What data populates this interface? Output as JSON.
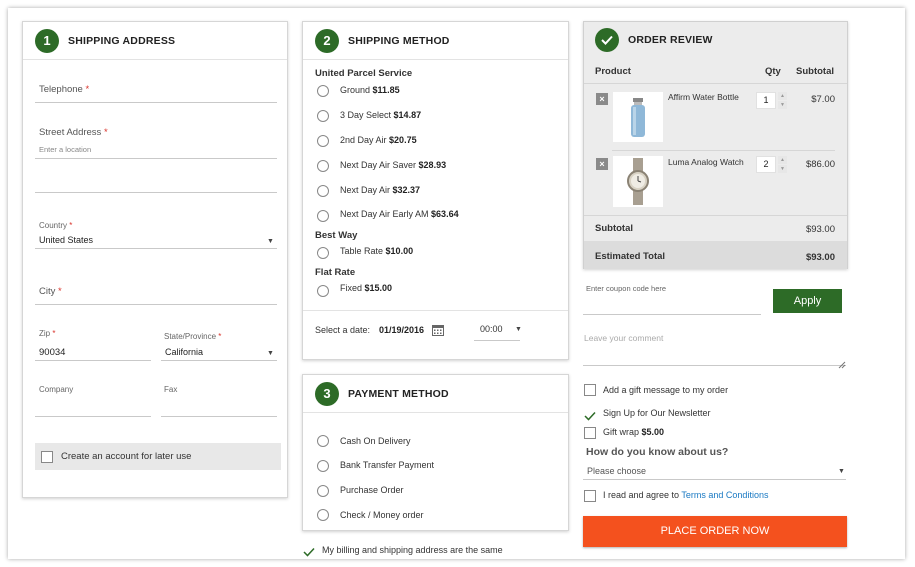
{
  "shipping_address": {
    "step": "1",
    "title": "SHIPPING ADDRESS",
    "telephone_label": "Telephone",
    "street_label": "Street Address",
    "street_placeholder": "Enter a location",
    "country_label": "Country",
    "country_value": "United States",
    "city_label": "City",
    "zip_label": "Zip",
    "zip_value": "90034",
    "state_label": "State/Province",
    "state_value": "California",
    "company_label": "Company",
    "fax_label": "Fax",
    "create_account_label": "Create an account for later use",
    "required_mark": "*"
  },
  "shipping_method": {
    "step": "2",
    "title": "SHIPPING METHOD",
    "groups": [
      {
        "name": "United Parcel Service",
        "options": [
          {
            "label": "Ground",
            "price": "$11.85"
          },
          {
            "label": "3 Day Select",
            "price": "$14.87"
          },
          {
            "label": "2nd Day Air",
            "price": "$20.75"
          },
          {
            "label": "Next Day Air Saver",
            "price": "$28.93"
          },
          {
            "label": "Next Day Air",
            "price": "$32.37"
          },
          {
            "label": "Next Day Air Early AM",
            "price": "$63.64"
          }
        ]
      },
      {
        "name": "Best Way",
        "options": [
          {
            "label": "Table Rate",
            "price": "$10.00"
          }
        ]
      },
      {
        "name": "Flat Rate",
        "options": [
          {
            "label": "Fixed",
            "price": "$15.00"
          }
        ]
      }
    ],
    "date_label": "Select a date:",
    "date_value": "01/19/2016",
    "time_value": "00:00"
  },
  "payment_method": {
    "step": "3",
    "title": "PAYMENT METHOD",
    "options": [
      "Cash On Delivery",
      "Bank Transfer Payment",
      "Purchase Order",
      "Check / Money order"
    ],
    "billing_same_label": "My billing and shipping address are the same"
  },
  "order_review": {
    "title": "ORDER REVIEW",
    "col_product": "Product",
    "col_qty": "Qty",
    "col_subtotal": "Subtotal",
    "items": [
      {
        "name": "Affirm Water Bottle",
        "qty": "1",
        "subtotal": "$7.00"
      },
      {
        "name": "Luma Analog Watch",
        "qty": "2",
        "subtotal": "$86.00"
      }
    ],
    "subtotal_label": "Subtotal",
    "subtotal_value": "$93.00",
    "estimated_label": "Estimated Total",
    "estimated_value": "$93.00"
  },
  "extras": {
    "coupon_placeholder": "Enter coupon code here",
    "apply_label": "Apply",
    "comment_placeholder": "Leave your comment",
    "gift_message_label": "Add a gift message to my order",
    "newsletter_label": "Sign Up for Our Newsletter",
    "gift_wrap_label": "Gift wrap",
    "gift_wrap_price": "$5.00",
    "how_know_label": "How do you know about us?",
    "how_know_value": "Please choose",
    "terms_prefix": "I read and agree to",
    "terms_link": "Terms and Conditions",
    "place_order_label": "PLACE ORDER NOW"
  },
  "colors": {
    "accent_green": "#2d6b27",
    "place_order": "#f4511e",
    "link_blue": "#1979c3"
  }
}
